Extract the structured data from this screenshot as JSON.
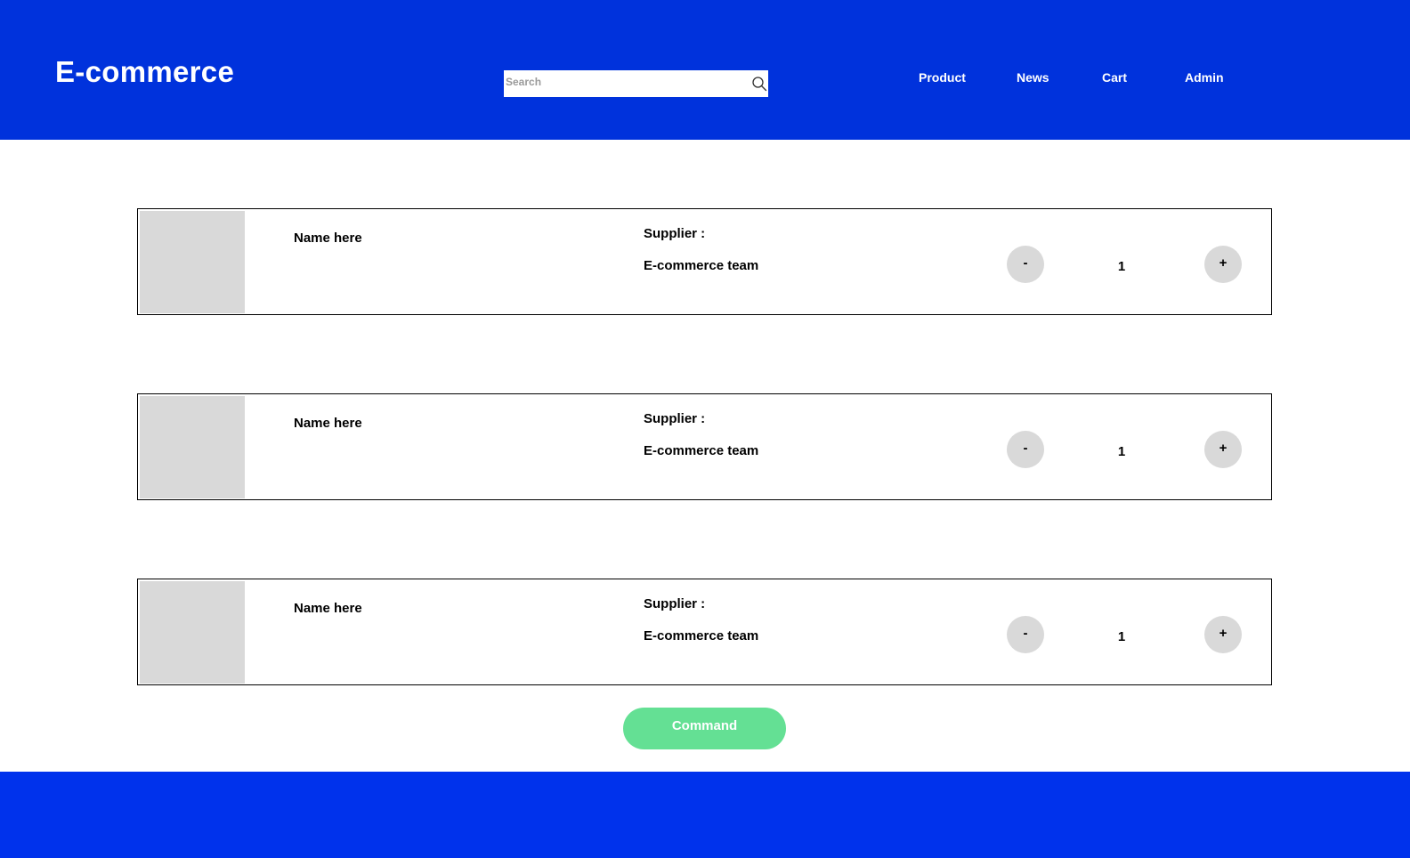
{
  "header": {
    "logo": "E-commerce",
    "background_color": "#0032DC",
    "search": {
      "placeholder": "Search",
      "value": "",
      "icon": "search-icon"
    },
    "nav": [
      {
        "label": "Product"
      },
      {
        "label": "News"
      },
      {
        "label": "Cart"
      },
      {
        "label": "Admin"
      }
    ]
  },
  "cart": {
    "items": [
      {
        "name": "Name here",
        "supplier_label": "Supplier :",
        "supplier": "E-commerce team",
        "minus_label": "-",
        "quantity": "1",
        "plus_label": "+"
      },
      {
        "name": "Name here",
        "supplier_label": "Supplier :",
        "supplier": "E-commerce team",
        "minus_label": "-",
        "quantity": "1",
        "plus_label": "+"
      },
      {
        "name": "Name here",
        "supplier_label": "Supplier :",
        "supplier": "E-commerce team",
        "minus_label": "-",
        "quantity": "1",
        "plus_label": "+"
      }
    ],
    "command_label": "Command",
    "command_color": "#64E094",
    "thumbnail_color": "#D9D9D9"
  },
  "footer": {
    "background_color": "#0032EC"
  }
}
